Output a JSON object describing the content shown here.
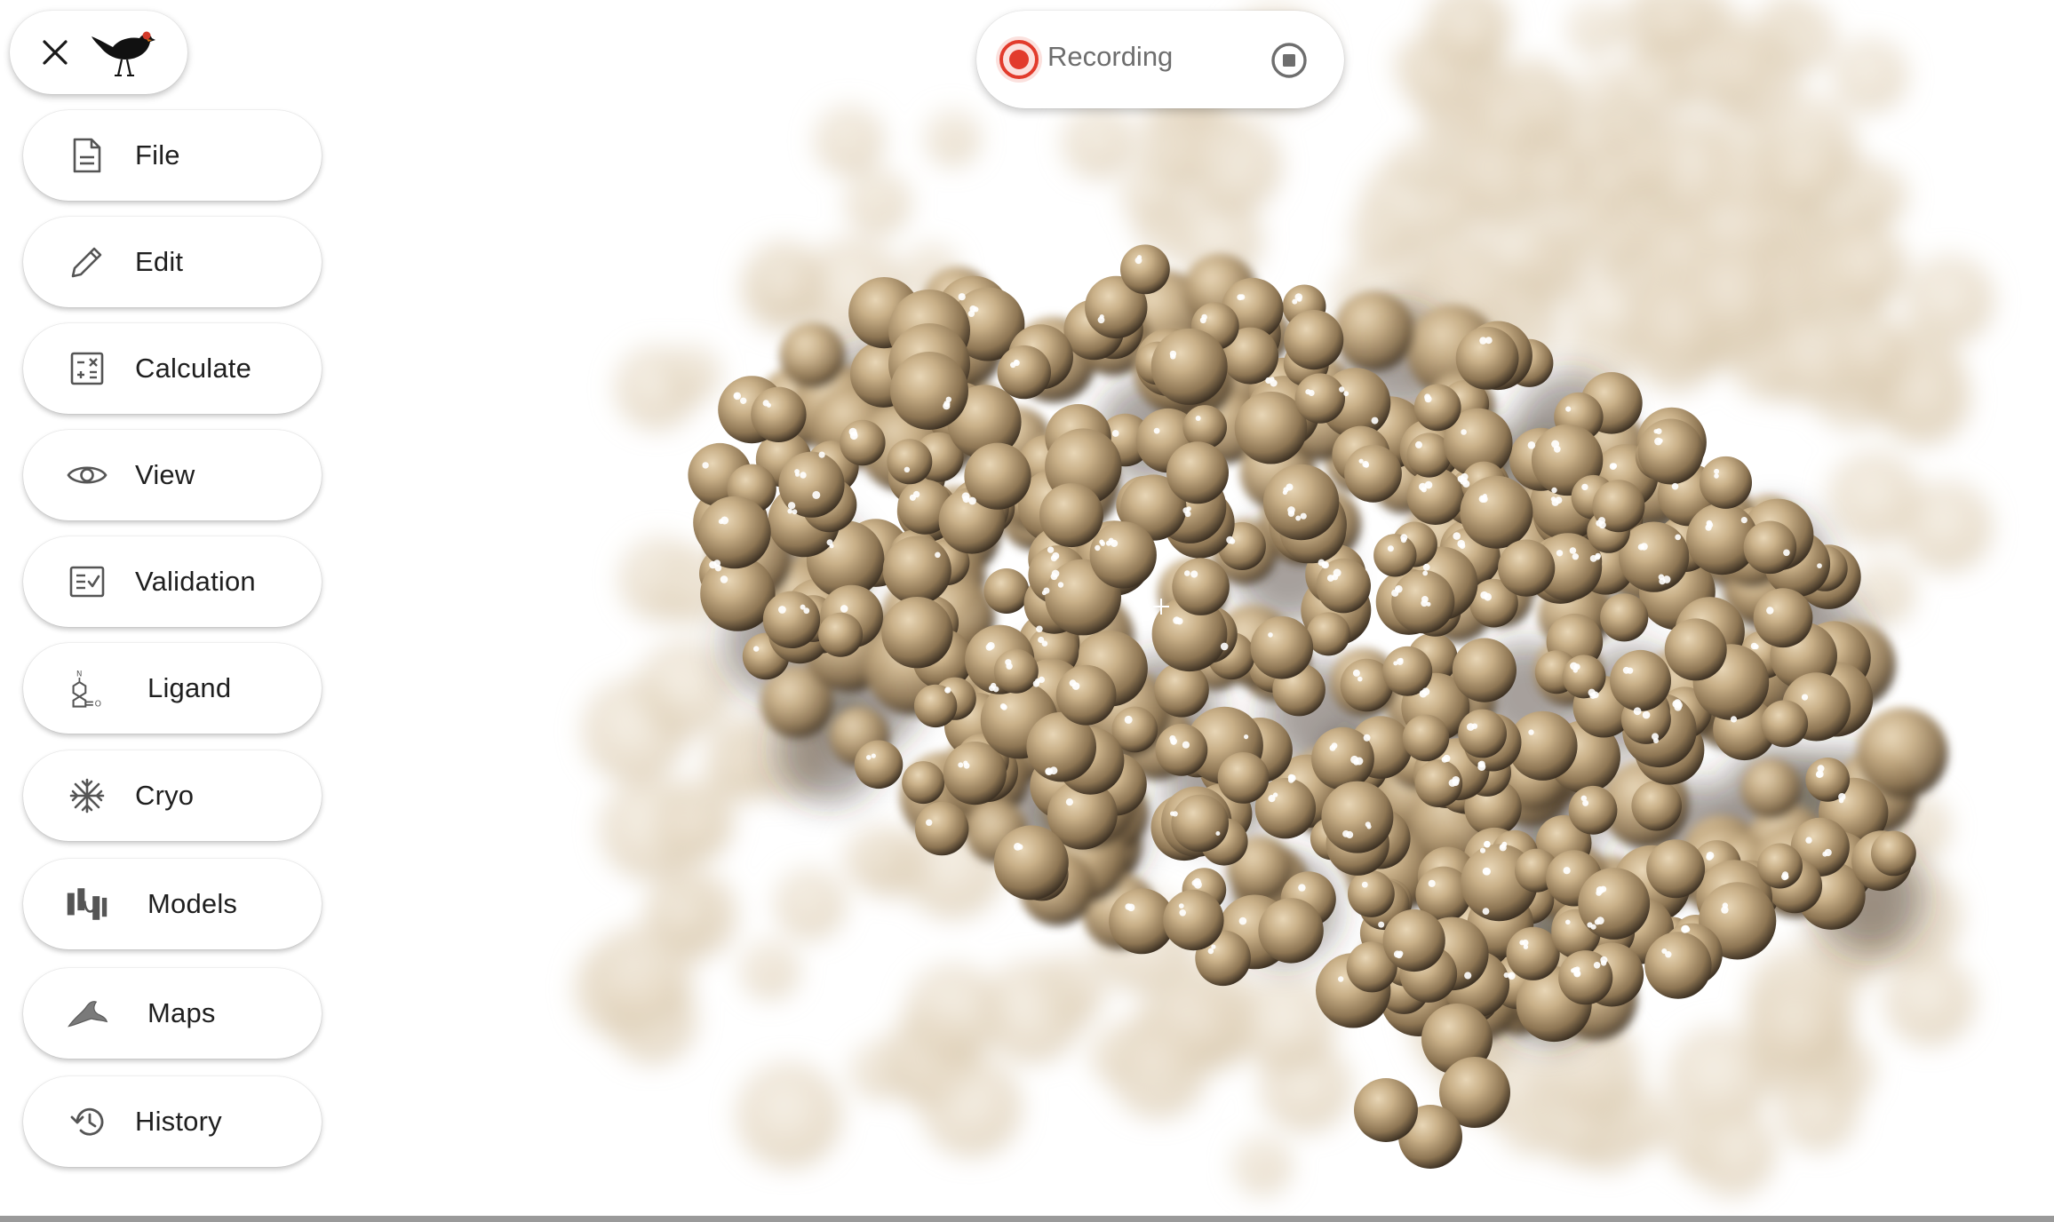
{
  "app": {
    "logo": "bird-logo-icon",
    "close_icon": "close-icon"
  },
  "recording": {
    "label": "Recording",
    "record_icon": "record-icon",
    "stop_icon": "stop-icon"
  },
  "menu": {
    "items": [
      {
        "label": "File",
        "icon": "file-icon"
      },
      {
        "label": "Edit",
        "icon": "pencil-icon"
      },
      {
        "label": "Calculate",
        "icon": "calculator-icon"
      },
      {
        "label": "View",
        "icon": "eye-icon"
      },
      {
        "label": "Validation",
        "icon": "validation-icon"
      },
      {
        "label": "Ligand",
        "icon": "ligand-molecule-icon"
      },
      {
        "label": "Cryo",
        "icon": "snowflake-icon"
      },
      {
        "label": "Models",
        "icon": "models-icon"
      },
      {
        "label": "Maps",
        "icon": "maps-icon"
      },
      {
        "label": "History",
        "icon": "history-icon"
      }
    ]
  },
  "viewer": {
    "surface_color": "#c6ad86",
    "crosshair_icon": "crosshair-icon"
  }
}
